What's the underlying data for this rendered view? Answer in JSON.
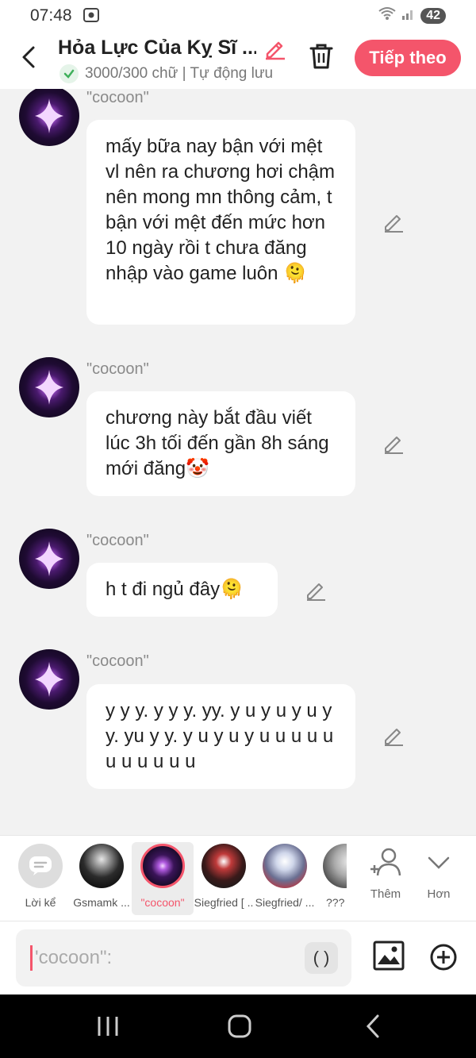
{
  "status_bar": {
    "time": "07:48",
    "battery": "42"
  },
  "header": {
    "title": "Hỏa Lực Của Kỵ Sĩ ...",
    "subtitle": "3000/300 chữ | Tự động lưu",
    "next_label": "Tiếp theo"
  },
  "messages": [
    {
      "author": "\"cocoon\"",
      "text": "mấy bữa nay bận với mệt vl nên ra chương hơi chậm nên mong mn thông cảm, t bận với mệt đến mức hơn 10 ngày rồi t chưa đăng nhập vào game luôn 🫠"
    },
    {
      "author": "\"cocoon\"",
      "text": "chương này bắt đầu viết lúc 3h tối đến gần 8h sáng mới đăng🤡"
    },
    {
      "author": "\"cocoon\"",
      "text": "h t đi ngủ đây🫠"
    },
    {
      "author": "\"cocoon\"",
      "text": "y y y. y y y. yy. y u y u y u y y. yu y y. y u y u y u u u u u u u u u u u"
    }
  ],
  "characters": [
    {
      "label": "Lời kể"
    },
    {
      "label": "Gsmamk ..."
    },
    {
      "label": "\"cocoon\""
    },
    {
      "label": "Siegfried [ .."
    },
    {
      "label": "Siegfried/ ..."
    },
    {
      "label": "???"
    }
  ],
  "char_actions": {
    "add_label": "Thêm",
    "more_label": "Hơn"
  },
  "input": {
    "placeholder": "'cocoon\":",
    "paren_label": "( )"
  },
  "colors": {
    "accent": "#f4556b",
    "bubble": "#ffffff",
    "background": "#f2f2f2"
  }
}
